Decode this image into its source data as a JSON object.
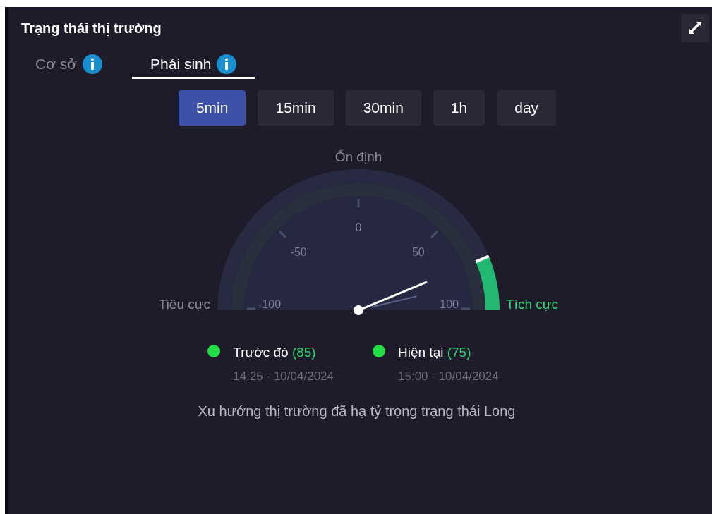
{
  "panel": {
    "title": "Trạng thái thị trường"
  },
  "tabs": [
    {
      "label": "Cơ sở",
      "selected": false
    },
    {
      "label": "Phái sinh",
      "selected": true
    }
  ],
  "timeframes": [
    {
      "label": "5min",
      "selected": true
    },
    {
      "label": "15min",
      "selected": false
    },
    {
      "label": "30min",
      "selected": false
    },
    {
      "label": "1h",
      "selected": false
    },
    {
      "label": "day",
      "selected": false
    }
  ],
  "gauge": {
    "top_label": "Ổn định",
    "left_label": "Tiêu cực",
    "right_label": "Tích cực",
    "ticks": [
      "-100",
      "-50",
      "0",
      "50",
      "100"
    ]
  },
  "legend": [
    {
      "label": "Trước đó",
      "value": "(85)",
      "time": "14:25 - 10/04/2024",
      "color": "#22dd44"
    },
    {
      "label": "Hiện tại",
      "value": "(75)",
      "time": "15:00 - 10/04/2024",
      "color": "#22dd44"
    }
  ],
  "summary": "Xu hướng thị trường đã hạ tỷ trọng trạng thái Long"
}
